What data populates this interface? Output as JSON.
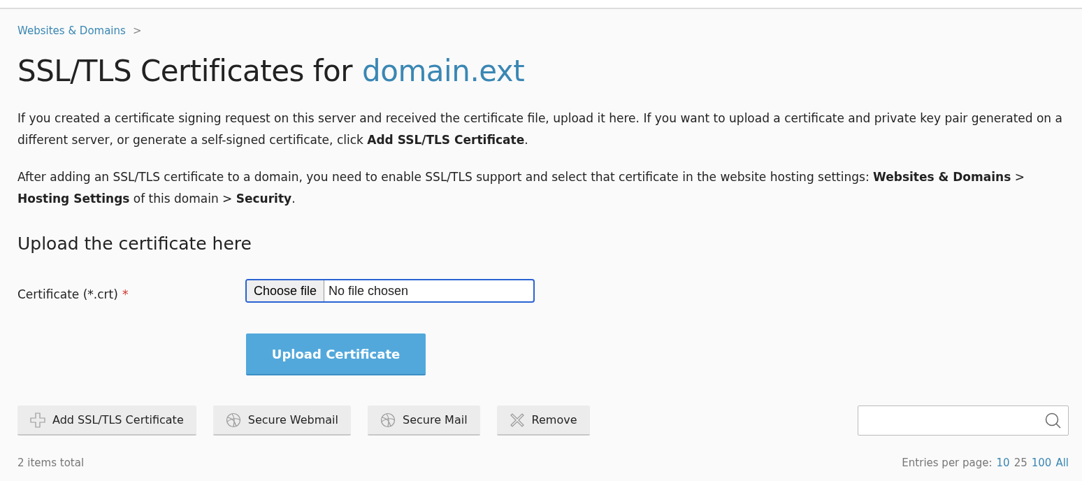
{
  "breadcrumb": {
    "label": "Websites & Domains",
    "separator": ">"
  },
  "title": {
    "text": "SSL/TLS Certificates for",
    "domain": "domain.ext"
  },
  "paragraphs": [
    "If you created a certificate signing request on this server and received the certificate file, upload it here. If you want to upload a certificate and private key pair generated on a different server, or generate a self-signed certificate, click **Add SSL/TLS Certificate**.",
    "After adding an SSL/TLS certificate to a domain, you need to enable SSL/TLS support and select that certificate in the website hosting settings: **Websites & Domains** > **Hosting Settings** of this domain > **Security**."
  ],
  "upload": {
    "heading": "Upload the certificate here",
    "label": "Certificate (*.crt)",
    "required_mark": "*",
    "choose_button": "Choose file",
    "file_status": "No file chosen",
    "submit": "Upload Certificate"
  },
  "toolbar": [
    {
      "kind": "add",
      "label": "Add SSL/TLS Certificate"
    },
    {
      "kind": "globe",
      "label": "Secure Webmail"
    },
    {
      "kind": "globe",
      "label": "Secure Mail"
    },
    {
      "kind": "remove",
      "label": "Remove"
    }
  ],
  "footer": {
    "total": "2 items total",
    "per_page_label": "Entries per page:",
    "per_page": [
      {
        "label": "10",
        "selected": false
      },
      {
        "label": "25",
        "selected": true
      },
      {
        "label": "100",
        "selected": false
      },
      {
        "label": "All",
        "selected": false
      }
    ]
  }
}
